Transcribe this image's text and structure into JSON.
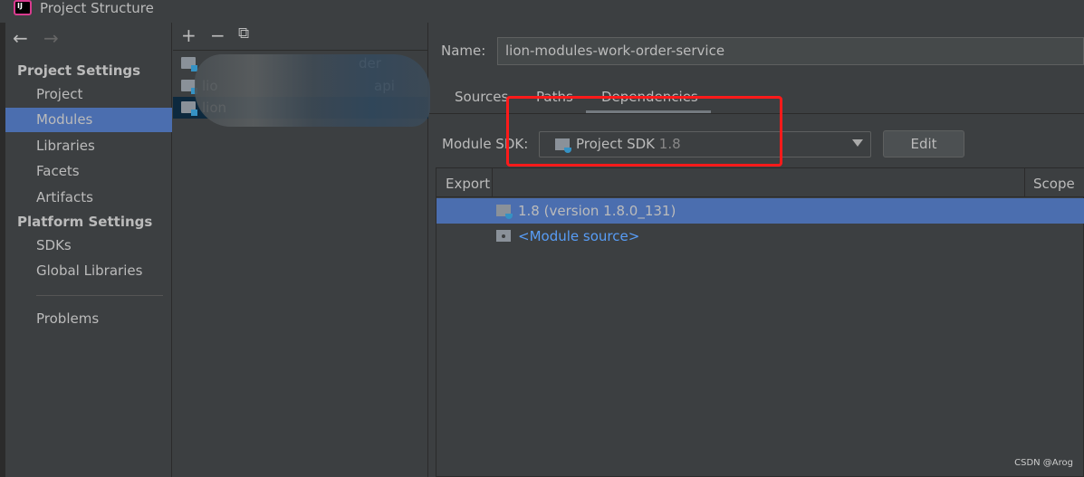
{
  "window": {
    "title": "Project Structure",
    "logo_text": "IJ"
  },
  "nav": {
    "back": "←",
    "forward": "→"
  },
  "sidebar": {
    "sections": [
      {
        "label": "Project Settings",
        "items": [
          {
            "label": "Project"
          },
          {
            "label": "Modules",
            "selected": true
          },
          {
            "label": "Libraries"
          },
          {
            "label": "Facets"
          },
          {
            "label": "Artifacts"
          }
        ]
      },
      {
        "label": "Platform Settings",
        "items": [
          {
            "label": "SDKs"
          },
          {
            "label": "Global Libraries"
          }
        ]
      }
    ],
    "problems": "Problems"
  },
  "modules": {
    "toolbar": {
      "add": "+",
      "remove": "−",
      "copy": "⧉"
    },
    "items": [
      {
        "label_start": "",
        "label_end": "der"
      },
      {
        "label_start": "lio",
        "label_end": "api"
      },
      {
        "label_start": "lion",
        "label_end": "",
        "selected": true
      }
    ]
  },
  "details": {
    "name_label": "Name:",
    "name_value": "lion-modules-work-order-service",
    "tabs": [
      {
        "label": "Sources"
      },
      {
        "label": "Paths"
      },
      {
        "label": "Dependencies",
        "active": true
      }
    ],
    "sdk_label": "Module SDK:",
    "sdk_value": "Project SDK",
    "sdk_version": "1.8",
    "edit_button": "Edit",
    "table": {
      "headers": {
        "export": "Export",
        "scope": "Scope"
      },
      "rows": [
        {
          "label": "1.8 (version 1.8.0_131)",
          "icon": "jdk-folder-icon",
          "selected": true
        },
        {
          "label": "<Module source>",
          "icon": "module-source-icon",
          "link": true
        }
      ]
    }
  },
  "annotation_color": "#ff1a1a",
  "accent": "#4b6eaf",
  "watermark": "CSDN @Arog"
}
